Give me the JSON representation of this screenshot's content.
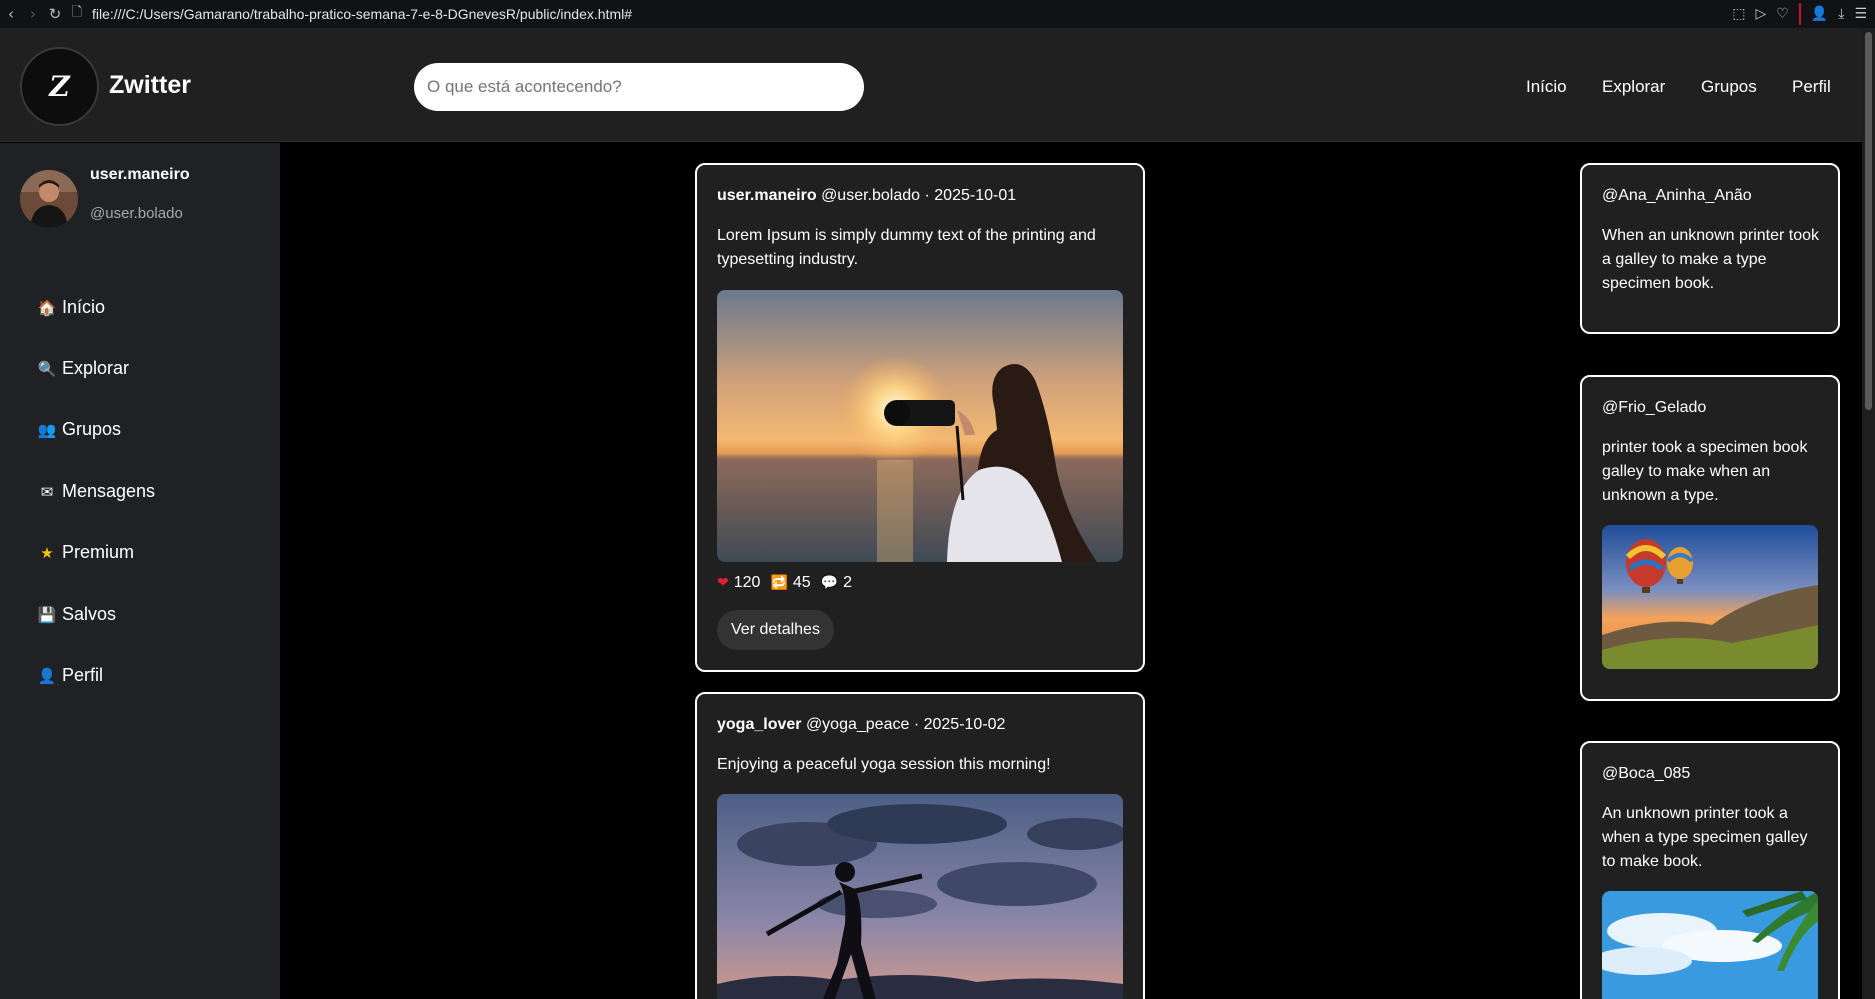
{
  "browser": {
    "url": "file:///C:/Users/Gamarano/trabalho-pratico-semana-7-e-8-DGnevesR/public/index.html#"
  },
  "header": {
    "logo_letter": "Z",
    "brand": "Zwitter",
    "search_placeholder": "O que está acontecendo?",
    "nav": [
      "Início",
      "Explorar",
      "Grupos",
      "Perfil"
    ]
  },
  "sidebar": {
    "username": "user.maneiro",
    "handle": "@user.bolado",
    "items": [
      {
        "icon": "home-icon",
        "glyph": "🏠",
        "label": "Início"
      },
      {
        "icon": "search-icon",
        "glyph": "🔍",
        "label": "Explorar"
      },
      {
        "icon": "groups-icon",
        "glyph": "👥",
        "label": "Grupos"
      },
      {
        "icon": "envelope-icon",
        "glyph": "✉",
        "label": "Mensagens"
      },
      {
        "icon": "star-icon",
        "glyph": "★",
        "label": "Premium"
      },
      {
        "icon": "floppy-icon",
        "glyph": "💾",
        "label": "Salvos"
      },
      {
        "icon": "user-icon",
        "glyph": "👤",
        "label": "Perfil"
      }
    ]
  },
  "feed": [
    {
      "user": "user.maneiro",
      "handle": "@user.bolado",
      "date": "· 2025-10-01",
      "text": "Lorem Ipsum is simply dummy text of the printing and typesetting industry.",
      "likes": "120",
      "retweets": "45",
      "comments": "2",
      "details_label": "Ver detalhes"
    },
    {
      "user": "yoga_lover",
      "handle": "@yoga_peace",
      "date": "· 2025-10-02",
      "text": "Enjoying a peaceful yoga session this morning!"
    }
  ],
  "trending": [
    {
      "handle": "@Ana_Aninha_Anão",
      "text": "When an unknown printer took a galley to make a type specimen book."
    },
    {
      "handle": "@Frio_Gelado",
      "text": "printer took a specimen book galley to make when an unknown a type."
    },
    {
      "handle": "@Boca_085",
      "text": "An unknown printer took a when a type specimen galley to make book."
    }
  ],
  "colors": {
    "page_bg": "#000000",
    "panel_bg": "#202020",
    "sidebar_bg": "#202124",
    "like_red": "#e0202e",
    "retweet_blue": "#2a7de1"
  }
}
